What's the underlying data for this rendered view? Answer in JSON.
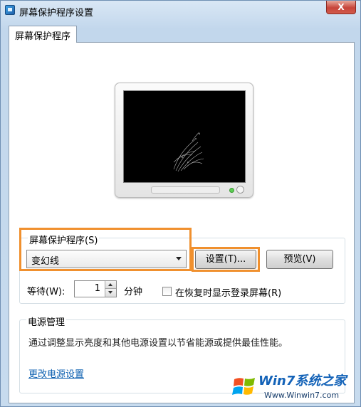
{
  "window": {
    "title": "屏幕保护程序设置",
    "close_label": "X"
  },
  "tabs": [
    {
      "label": "屏幕保护程序",
      "selected": true
    }
  ],
  "screensaver": {
    "group_label": "屏幕保护程序(S)",
    "selected": "变幻线",
    "settings_button": "设置(T)...",
    "preview_button": "预览(V)",
    "wait_label": "等待(W):",
    "wait_value": "1",
    "minutes_label": "分钟",
    "resume_checkbox_label": "在恢复时显示登录屏幕(R)",
    "resume_checked": false
  },
  "power": {
    "group_label": "电源管理",
    "description": "通过调整显示亮度和其他电源设置以节省能源或提供最佳性能。",
    "link": "更改电源设置"
  },
  "watermark": {
    "brand": "Win7系统之家",
    "url": "Www.Winwin7.com"
  },
  "colors": {
    "highlight": "#f0902e",
    "link": "#0b5fb0",
    "window_bg": "#c7dbee"
  }
}
